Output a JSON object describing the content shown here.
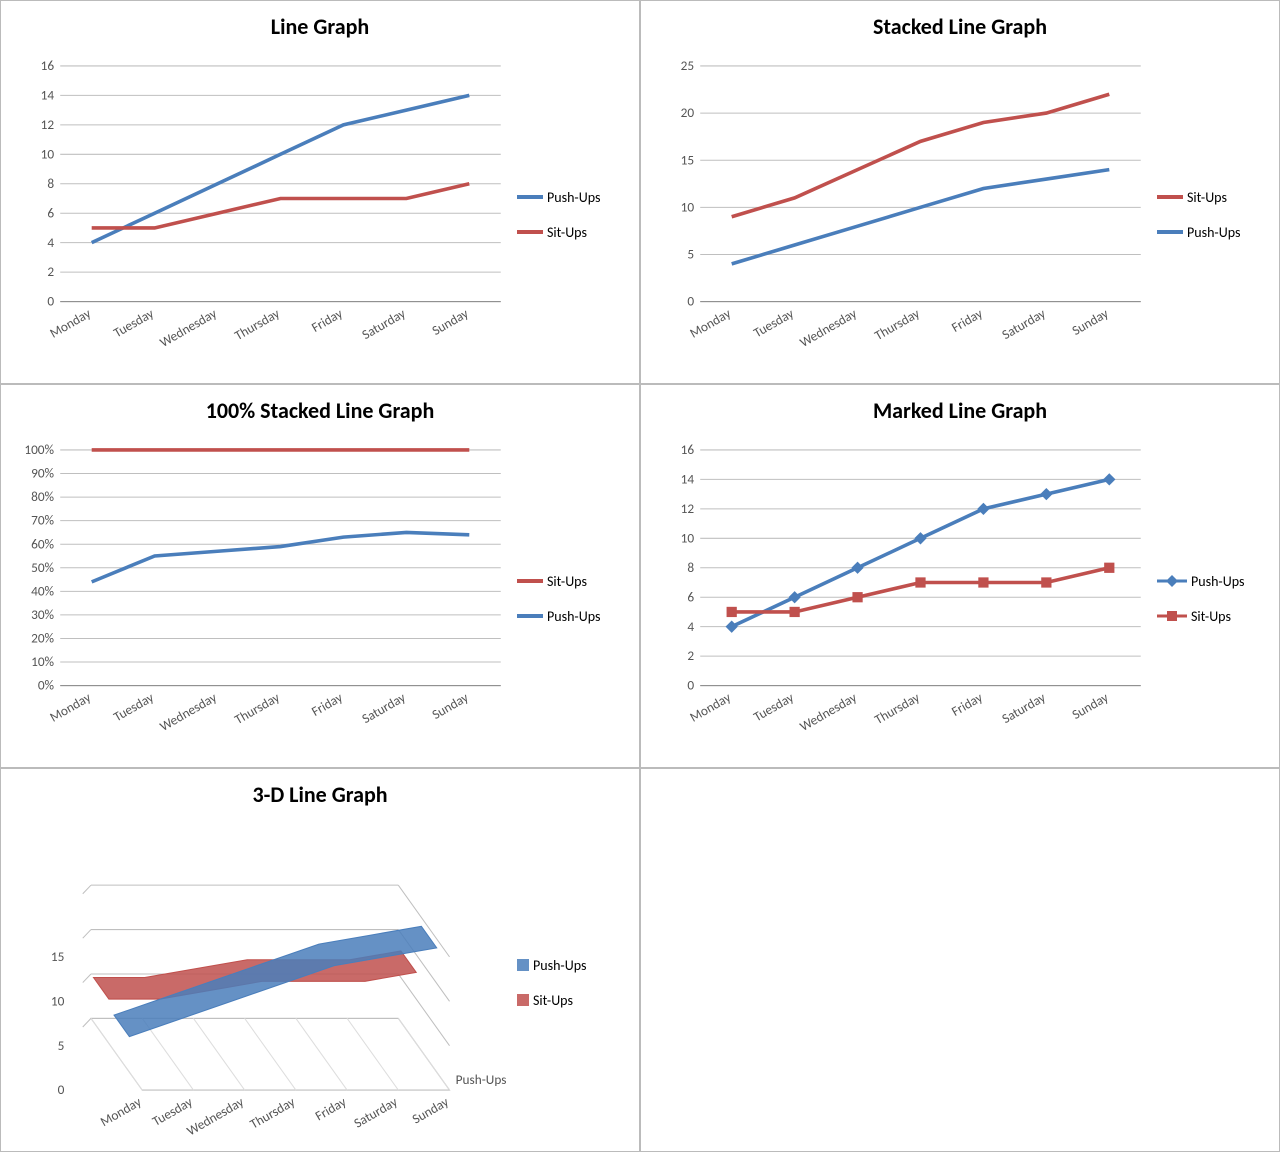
{
  "categories": [
    "Monday",
    "Tuesday",
    "Wednesday",
    "Thursday",
    "Friday",
    "Saturday",
    "Sunday"
  ],
  "pushups": [
    4,
    6,
    8,
    10,
    12,
    13,
    14
  ],
  "situps": [
    5,
    5,
    6,
    7,
    7,
    7,
    8
  ],
  "colors": {
    "pushups": "#4A7EBB",
    "situps": "#C0504D"
  },
  "chart_data": [
    {
      "type": "line",
      "title": "Line Graph",
      "categories": [
        "Monday",
        "Tuesday",
        "Wednesday",
        "Thursday",
        "Friday",
        "Saturday",
        "Sunday"
      ],
      "series": [
        {
          "name": "Push-Ups",
          "values": [
            4,
            6,
            8,
            10,
            12,
            13,
            14
          ]
        },
        {
          "name": "Sit-Ups",
          "values": [
            5,
            5,
            6,
            7,
            7,
            7,
            8
          ]
        }
      ],
      "ylim": [
        0,
        16
      ],
      "ystep": 2,
      "legend_order": [
        "Push-Ups",
        "Sit-Ups"
      ]
    },
    {
      "type": "line_stacked",
      "title": "Stacked Line Graph",
      "categories": [
        "Monday",
        "Tuesday",
        "Wednesday",
        "Thursday",
        "Friday",
        "Saturday",
        "Sunday"
      ],
      "series": [
        {
          "name": "Push-Ups",
          "values": [
            4,
            6,
            8,
            10,
            12,
            13,
            14
          ]
        },
        {
          "name": "Sit-Ups",
          "values": [
            9,
            11,
            14,
            17,
            19,
            20,
            22
          ]
        }
      ],
      "ylim": [
        0,
        25
      ],
      "ystep": 5,
      "legend_order": [
        "Sit-Ups",
        "Push-Ups"
      ]
    },
    {
      "type": "line_100pct",
      "title": "100% Stacked Line Graph",
      "categories": [
        "Monday",
        "Tuesday",
        "Wednesday",
        "Thursday",
        "Friday",
        "Saturday",
        "Sunday"
      ],
      "series": [
        {
          "name": "Push-Ups",
          "values_pct": [
            44,
            55,
            57,
            59,
            63,
            65,
            64
          ]
        },
        {
          "name": "Sit-Ups",
          "values_pct": [
            100,
            100,
            100,
            100,
            100,
            100,
            100
          ]
        }
      ],
      "ylim": [
        0,
        100
      ],
      "ystep": 10,
      "ysuffix": "%",
      "legend_order": [
        "Sit-Ups",
        "Push-Ups"
      ]
    },
    {
      "type": "line_marked",
      "title": "Marked Line Graph",
      "categories": [
        "Monday",
        "Tuesday",
        "Wednesday",
        "Thursday",
        "Friday",
        "Saturday",
        "Sunday"
      ],
      "series": [
        {
          "name": "Push-Ups",
          "values": [
            4,
            6,
            8,
            10,
            12,
            13,
            14
          ],
          "marker": "diamond"
        },
        {
          "name": "Sit-Ups",
          "values": [
            5,
            5,
            6,
            7,
            7,
            7,
            8
          ],
          "marker": "square"
        }
      ],
      "ylim": [
        0,
        16
      ],
      "ystep": 2,
      "legend_order": [
        "Push-Ups",
        "Sit-Ups"
      ]
    },
    {
      "type": "line_3d",
      "title": "3-D Line Graph",
      "categories": [
        "Monday",
        "Tuesday",
        "Wednesday",
        "Thursday",
        "Friday",
        "Saturday",
        "Sunday"
      ],
      "series": [
        {
          "name": "Push-Ups",
          "values": [
            4,
            6,
            8,
            10,
            12,
            13,
            14
          ]
        },
        {
          "name": "Sit-Ups",
          "values": [
            5,
            5,
            6,
            7,
            7,
            7,
            8
          ]
        }
      ],
      "ylim": [
        0,
        15
      ],
      "ystep": 5,
      "legend_order": [
        "Push-Ups",
        "Sit-Ups"
      ],
      "depth_axis_label": "Push-Ups"
    }
  ]
}
